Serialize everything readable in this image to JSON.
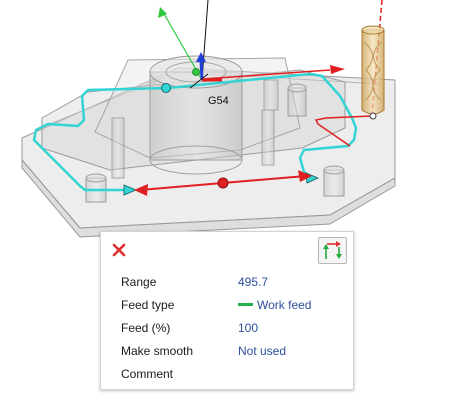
{
  "viewport": {
    "work_offset_label": "G54",
    "colors": {
      "toolpath": "#33d4d4",
      "rapid": "#e02020",
      "axis_x": "#e02020",
      "axis_y": "#2dc83c",
      "axis_z": "#1f3fd8",
      "tool": "#e8c88a"
    }
  },
  "panel": {
    "close_icon": "close-icon",
    "mode_icon": "feed-direction-icon",
    "fields": [
      {
        "label": "Range",
        "value": "495.7"
      },
      {
        "label": "Feed type",
        "value": "Work feed",
        "swatch": "#22b04a"
      },
      {
        "label": "Feed (%)",
        "value": "100"
      },
      {
        "label": "Make smooth",
        "value": "Not used"
      },
      {
        "label": "Comment",
        "value": ""
      }
    ]
  }
}
